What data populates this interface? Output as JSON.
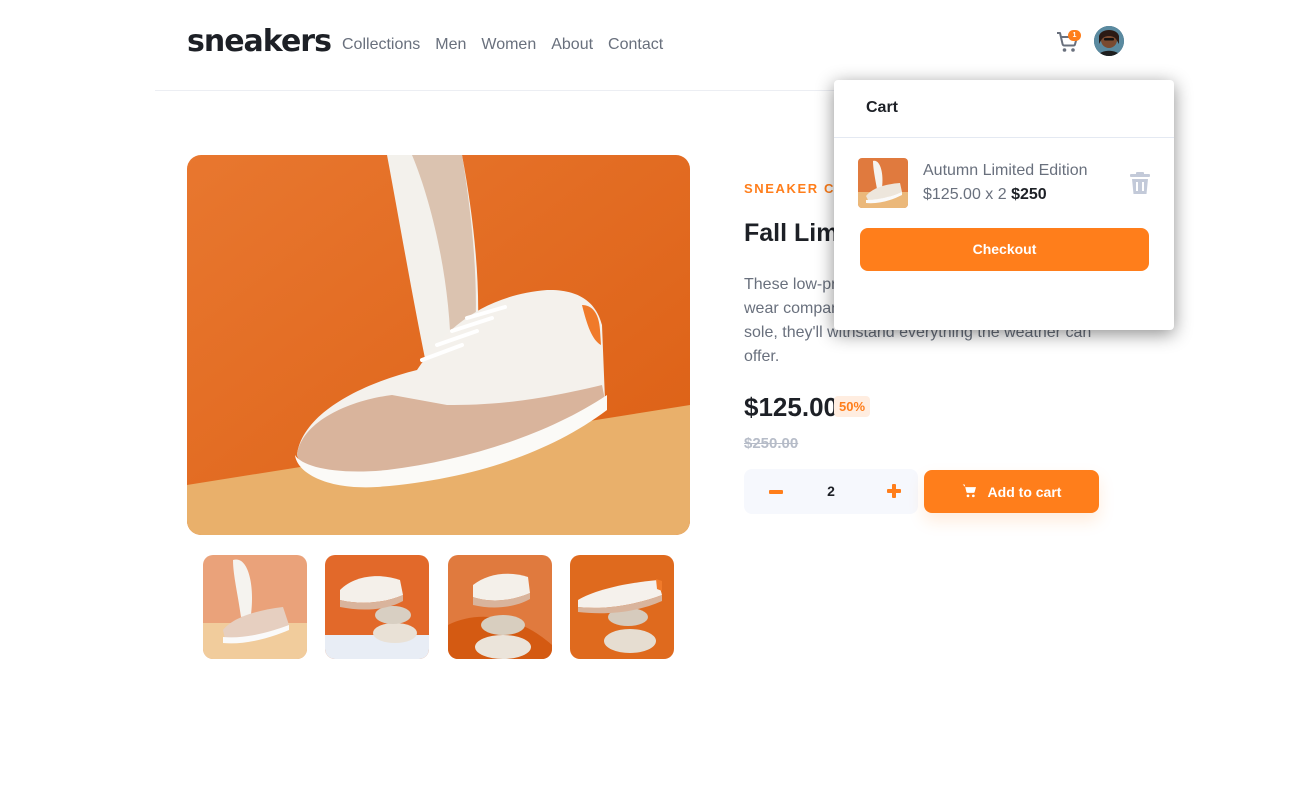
{
  "brand": {
    "logo": "sneakers",
    "accent": "#ff7e1b"
  },
  "nav": {
    "items": [
      "Collections",
      "Men",
      "Women",
      "About",
      "Contact"
    ]
  },
  "header": {
    "cart_count": "1",
    "cart_icon": "cart-icon",
    "avatar": "user-avatar"
  },
  "product": {
    "company": "SNEAKER COMPANY",
    "title": "Fall Limited Edition Sneakers",
    "description": "These low-profile sneakers are your perfect casual wear companion. Featuring a durable rubber outer sole, they'll withstand everything the weather can offer.",
    "price": "$125.00",
    "discount": "50%",
    "old_price": "$250.00",
    "quantity": "2",
    "add_to_cart": "Add to cart"
  },
  "cart": {
    "title": "Cart",
    "item": {
      "name": "Autumn Limited Edition",
      "unit_price": "$125.00 x 2",
      "total": "$250"
    },
    "checkout": "Checkout"
  }
}
